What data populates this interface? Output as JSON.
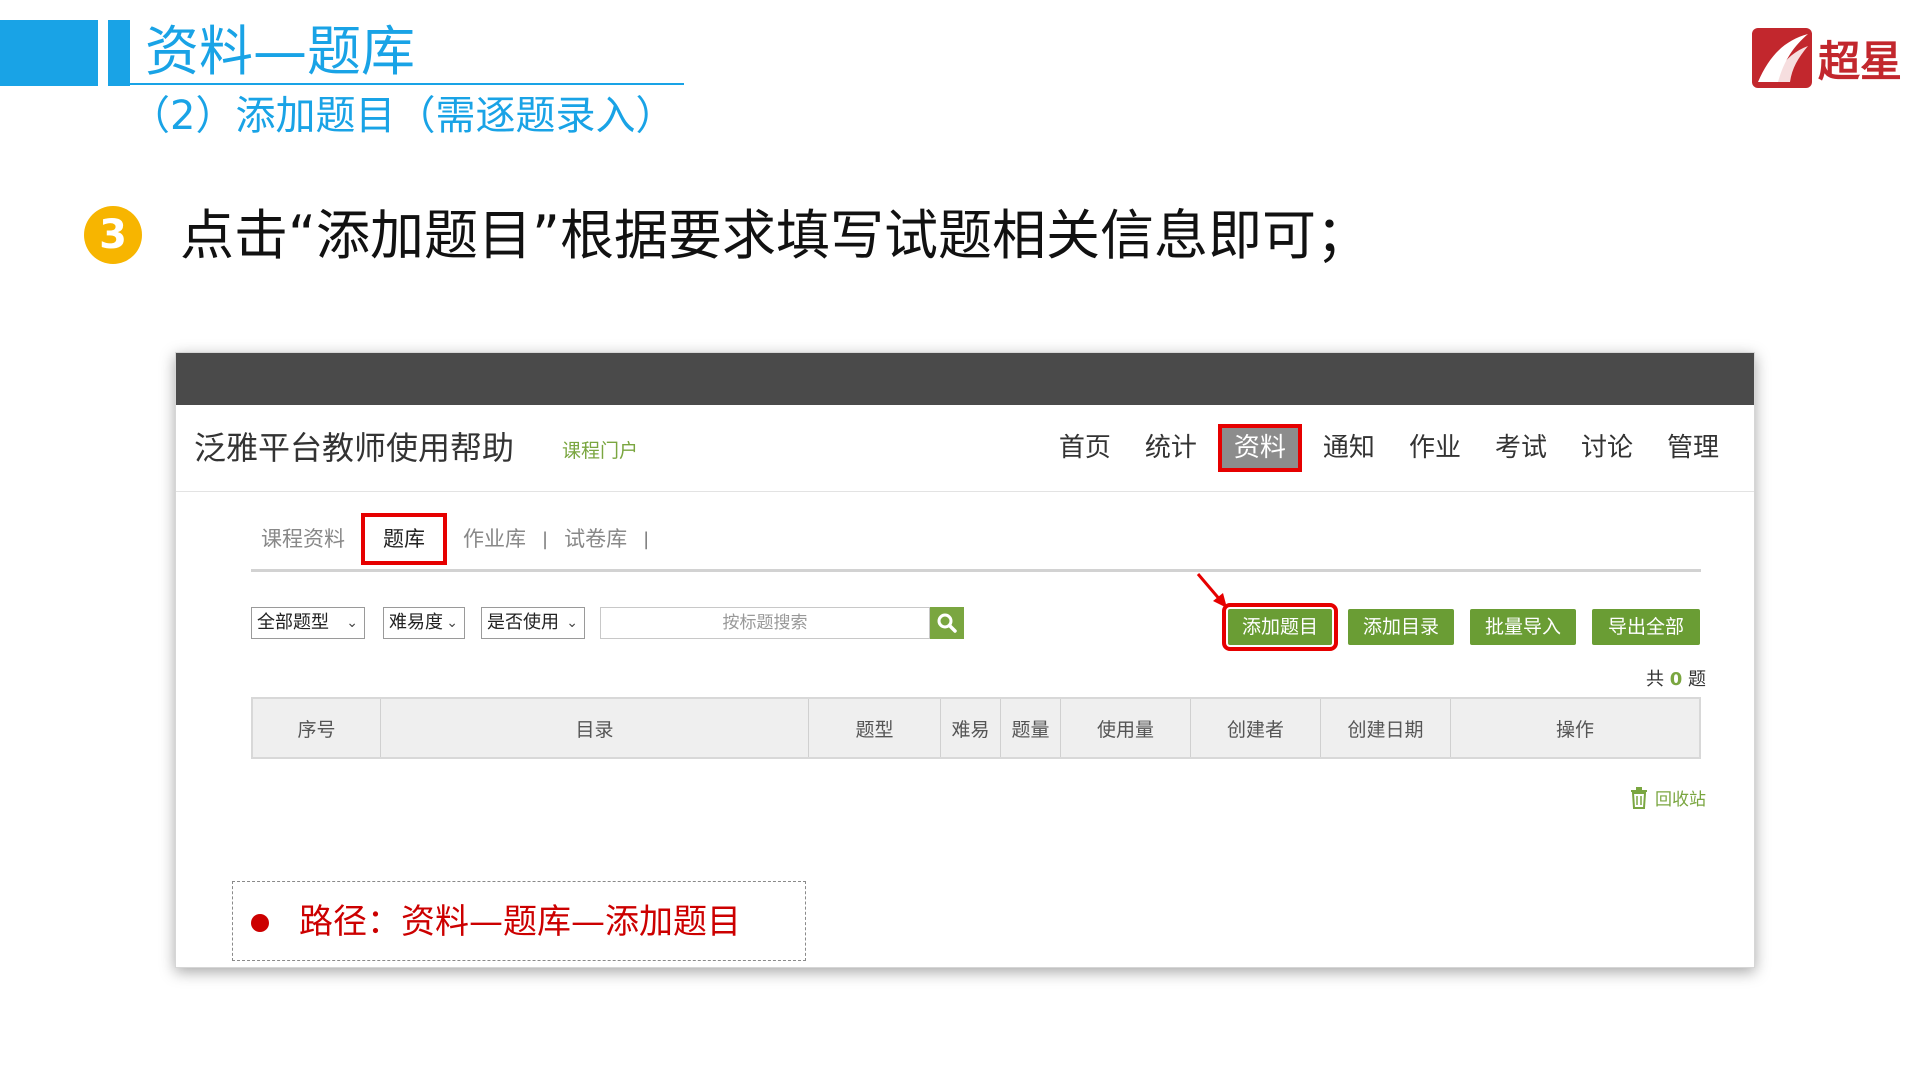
{
  "slide": {
    "title": "资料—题库",
    "subtitle": "（2）添加题目（需逐题录入）",
    "step_number": "3",
    "step_text": "点击“添加题目”根据要求填写试题相关信息即可；",
    "brand_logo": "超星"
  },
  "app": {
    "site_title": "泛雅平台教师使用帮助",
    "portal_link": "课程门户",
    "nav": [
      {
        "label": "首页",
        "active": false
      },
      {
        "label": "统计",
        "active": false
      },
      {
        "label": "资料",
        "active": true
      },
      {
        "label": "通知",
        "active": false
      },
      {
        "label": "作业",
        "active": false
      },
      {
        "label": "考试",
        "active": false
      },
      {
        "label": "讨论",
        "active": false
      },
      {
        "label": "管理",
        "active": false
      }
    ],
    "subtabs": [
      {
        "label": "课程资料",
        "active": false
      },
      {
        "label": "题库",
        "active": true
      },
      {
        "label": "作业库",
        "active": false
      },
      {
        "label": "试卷库",
        "active": false
      }
    ],
    "subtab_separator": "|",
    "filters": {
      "type": "全部题型",
      "difficulty": "难易度",
      "used": "是否使用"
    },
    "search": {
      "placeholder": "按标题搜索"
    },
    "actions": {
      "add_question": "添加题目",
      "add_directory": "添加目录",
      "batch_import": "批量导入",
      "export_all": "导出全部"
    },
    "count": {
      "prefix": "共",
      "value": "0",
      "suffix": "题"
    },
    "table_headers": [
      "序号",
      "目录",
      "题型",
      "难易",
      "题量",
      "使用量",
      "创建者",
      "创建日期",
      "操作"
    ],
    "recycle": "回收站"
  },
  "path_note": "路径：资料—题库—添加题目",
  "colors": {
    "header_blue": "#19a3e6",
    "green": "#6a9d34",
    "highlight_red": "#e60000",
    "note_red": "#cc0000"
  }
}
